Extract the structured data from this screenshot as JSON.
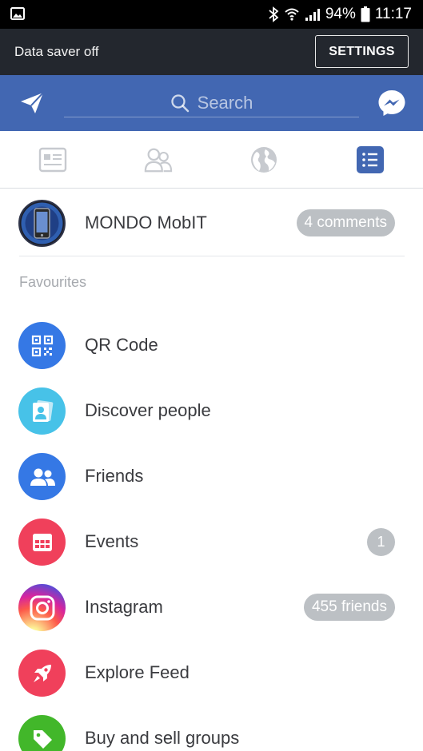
{
  "status_bar": {
    "battery": "94%",
    "time": "11:17"
  },
  "data_saver": {
    "text": "Data saver off",
    "button": "SETTINGS"
  },
  "header": {
    "search_placeholder": "Search"
  },
  "profile_row": {
    "name": "MONDO MobIT",
    "badge": "4 comments"
  },
  "favourites": {
    "title": "Favourites",
    "items": [
      {
        "label": "QR Code",
        "icon": "qr-code-icon",
        "color": "#3578e5"
      },
      {
        "label": "Discover people",
        "icon": "discover-people-icon",
        "color": "#47c2e8"
      },
      {
        "label": "Friends",
        "icon": "friends-icon",
        "color": "#3578e5"
      },
      {
        "label": "Events",
        "icon": "calendar-icon",
        "color": "#f0405b",
        "badge": "1"
      },
      {
        "label": "Instagram",
        "icon": "instagram-icon",
        "color": "#c13584",
        "badge": "455 friends"
      },
      {
        "label": "Explore Feed",
        "icon": "rocket-icon",
        "color": "#f0405b"
      },
      {
        "label": "Buy and sell groups",
        "icon": "price-tag-icon",
        "color": "#42b72a"
      }
    ]
  },
  "colors": {
    "brand_blue": "#4267b2",
    "saver_bg": "#23272e",
    "badge_grey": "#bcc0c4"
  }
}
